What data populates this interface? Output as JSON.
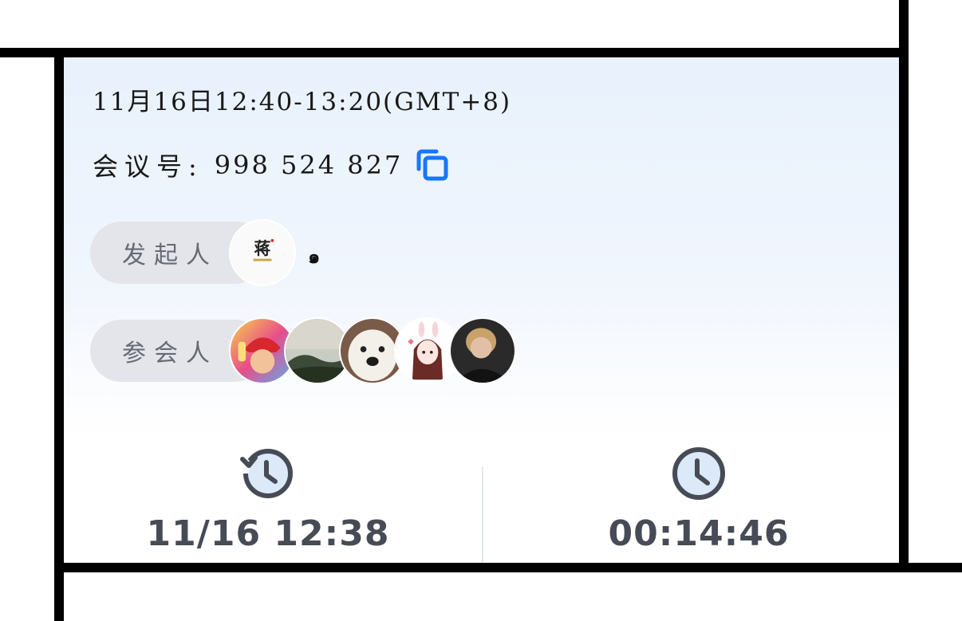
{
  "meeting": {
    "time_range": "11月16日12:40-13:20(GMT+8)",
    "number_label": "会议号:",
    "number_value": "998 524 827"
  },
  "host": {
    "label": "发起人",
    "name": "๑",
    "avatar_text": "蒋"
  },
  "attendees": {
    "label": "参会人",
    "count": 5
  },
  "stats": {
    "start_time": "11/16 12:38",
    "duration": "00:14:46"
  },
  "colors": {
    "accent": "#1677ff",
    "stat_text": "#464b56",
    "pill_bg": "#e3e5ea",
    "card_gradient_top": "#e8f1fc"
  },
  "icons": {
    "copy": "copy-icon",
    "history": "history-clock-icon",
    "duration": "clock-icon"
  }
}
